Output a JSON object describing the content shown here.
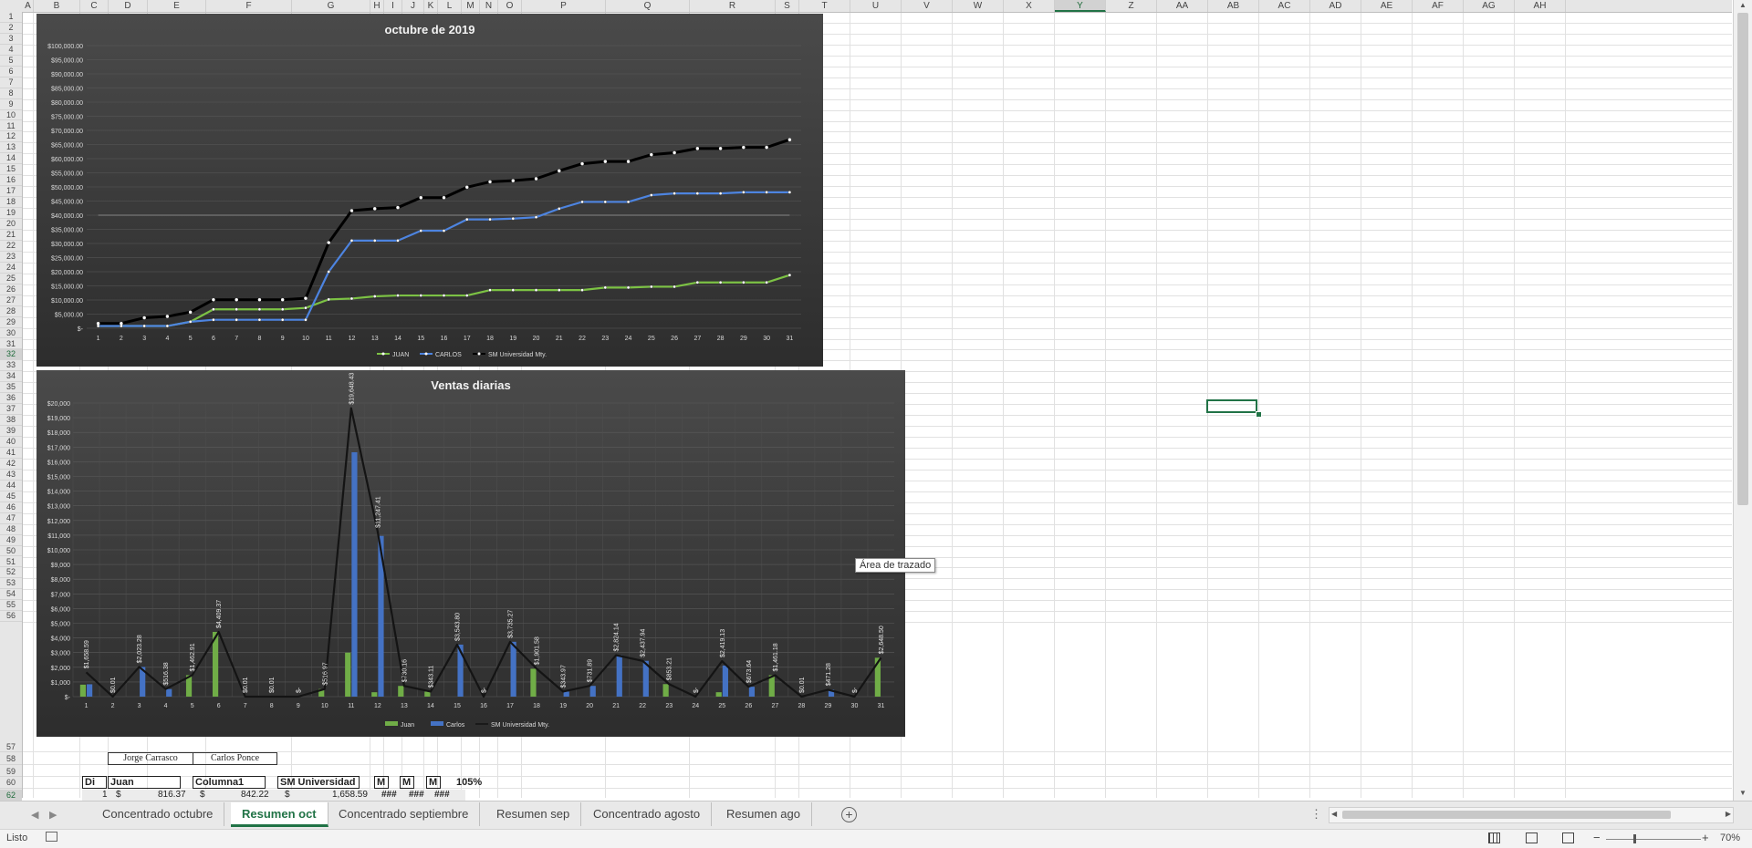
{
  "columns": [
    "A",
    "B",
    "C",
    "D",
    "E",
    "F",
    "G",
    "H",
    "I",
    "J",
    "K",
    "L",
    "M",
    "N",
    "O",
    "P",
    "Q",
    "R",
    "S",
    "T",
    "U",
    "V",
    "W",
    "X",
    "Y",
    "Z",
    "AA",
    "AB",
    "AC",
    "AD",
    "AE",
    "AF",
    "AG",
    "AH"
  ],
  "selected_column": "Y",
  "rows_top": [
    "1",
    "2",
    "3",
    "4",
    "5",
    "6",
    "7",
    "8",
    "9",
    "10",
    "11",
    "12",
    "13",
    "14",
    "15",
    "16",
    "17",
    "18",
    "19",
    "20",
    "21",
    "22",
    "23",
    "24",
    "25",
    "26",
    "27",
    "28",
    "29",
    "30",
    "31",
    "32",
    "33",
    "34",
    "35",
    "36",
    "37",
    "38",
    "39",
    "40",
    "41",
    "42",
    "43",
    "44",
    "45",
    "46",
    "47",
    "48",
    "49",
    "50",
    "51",
    "52",
    "53",
    "54",
    "55",
    "56"
  ],
  "rows_bottom": [
    "57",
    "58",
    "59",
    "60",
    "62"
  ],
  "selected_row": "32",
  "chart1": {
    "title": "octubre de 2019",
    "y_ticks": [
      "$100,000.00",
      "$95,000.00",
      "$90,000.00",
      "$85,000.00",
      "$80,000.00",
      "$75,000.00",
      "$70,000.00",
      "$65,000.00",
      "$60,000.00",
      "$55,000.00",
      "$50,000.00",
      "$45,000.00",
      "$40,000.00",
      "$35,000.00",
      "$30,000.00",
      "$25,000.00",
      "$20,000.00",
      "$15,000.00",
      "$10,000.00",
      "$5,000.00",
      "$-"
    ],
    "legend": [
      "JUAN",
      "CARLOS",
      "SM Universidad  Mty."
    ]
  },
  "chart2": {
    "title": "Ventas diarias",
    "y_ticks": [
      "$20,000",
      "$19,000",
      "$18,000",
      "$17,000",
      "$16,000",
      "$15,000",
      "$14,000",
      "$13,000",
      "$12,000",
      "$11,000",
      "$10,000",
      "$9,000",
      "$8,000",
      "$7,000",
      "$6,000",
      "$5,000",
      "$4,000",
      "$3,000",
      "$2,000",
      "$1,000",
      "$-"
    ],
    "data_labels": [
      "$1,658.59",
      "$0.01",
      "$2,023.28",
      "$516.38",
      "$1,462.91",
      "$4,409.37",
      "$0.01",
      "$0.01",
      "$-",
      "$516.97",
      "$19,648.43",
      "$11,247.41",
      "$730.16",
      "$343.11",
      "$3,543.80",
      "$-",
      "$3,735.27",
      "$1,901.58",
      "$343.97",
      "$731.89",
      "$2,824.14",
      "$2,437.94",
      "$853.21",
      "$-",
      "$2,419.13",
      "$673.64",
      "$1,461.18",
      "$0.01",
      "$471.28",
      "$-",
      "$2,648.50"
    ],
    "legend": [
      "Juan",
      "Carlos",
      "SM Universidad  Mty."
    ]
  },
  "chart_data": [
    {
      "type": "line",
      "title": "octubre de 2019",
      "x": [
        1,
        2,
        3,
        4,
        5,
        6,
        7,
        8,
        9,
        10,
        11,
        12,
        13,
        14,
        15,
        16,
        17,
        18,
        19,
        20,
        21,
        22,
        23,
        24,
        25,
        26,
        27,
        28,
        29,
        30,
        31
      ],
      "ylim": [
        0,
        100000
      ],
      "reference_line": 40000,
      "series": [
        {
          "name": "JUAN",
          "color": "#7cc244",
          "values": [
            800,
            800,
            800,
            800,
            2300,
            6700,
            6700,
            6700,
            6700,
            7200,
            10200,
            10500,
            11300,
            11600,
            11600,
            11600,
            11600,
            13500,
            13500,
            13500,
            13500,
            13500,
            14400,
            14400,
            14700,
            14700,
            16200,
            16200,
            16200,
            16200,
            18800
          ]
        },
        {
          "name": "CARLOS",
          "color": "#4d84e0",
          "values": [
            800,
            800,
            800,
            800,
            2300,
            3000,
            3000,
            3000,
            3000,
            3000,
            20000,
            31000,
            31000,
            31000,
            34500,
            34500,
            38500,
            38500,
            38800,
            39300,
            42300,
            44700,
            44700,
            44700,
            47100,
            47700,
            47700,
            47700,
            48100,
            48100,
            48100
          ]
        },
        {
          "name": "SM Universidad  Mty.",
          "color": "#000000",
          "values": [
            1700,
            1700,
            3700,
            4200,
            5700,
            10100,
            10100,
            10100,
            10100,
            10600,
            30300,
            41600,
            42300,
            42700,
            46200,
            46200,
            49900,
            51800,
            52200,
            52900,
            55700,
            58200,
            59000,
            59000,
            61400,
            62100,
            63600,
            63600,
            64000,
            64000,
            66700
          ]
        }
      ]
    },
    {
      "type": "bar",
      "title": "Ventas diarias",
      "categories": [
        "1",
        "2",
        "3",
        "4",
        "5",
        "6",
        "7",
        "8",
        "9",
        "10",
        "11",
        "12",
        "13",
        "14",
        "15",
        "16",
        "17",
        "18",
        "19",
        "20",
        "21",
        "22",
        "23",
        "24",
        "25",
        "26",
        "27",
        "28",
        "29",
        "30",
        "31"
      ],
      "ylim": [
        0,
        20000
      ],
      "series": [
        {
          "name": "Juan",
          "type": "bar",
          "color": "#70ad47",
          "values": [
            816.37,
            0.01,
            0,
            0,
            1462.91,
            4409.37,
            0.01,
            0.01,
            0,
            516.97,
            3000,
            300,
            730.16,
            343.11,
            0,
            0,
            0,
            1901.58,
            0,
            0,
            0,
            0,
            853.21,
            0,
            300,
            0,
            1461.18,
            0.01,
            0,
            0,
            2648.5
          ]
        },
        {
          "name": "Carlos",
          "type": "bar",
          "color": "#4472c4",
          "values": [
            842.22,
            0,
            2023.28,
            516.38,
            0,
            0,
            0,
            0,
            0,
            0,
            16648.43,
            10947.41,
            0,
            0,
            3543.8,
            0,
            3735.27,
            0,
            343.97,
            731.89,
            2824.14,
            2437.94,
            0,
            0,
            2119.13,
            673.64,
            0,
            0,
            471.28,
            0,
            0
          ]
        },
        {
          "name": "SM Universidad  Mty.",
          "type": "line",
          "color": "#1a1a1a",
          "values": [
            1658.59,
            0.01,
            2023.28,
            516.38,
            1462.91,
            4409.37,
            0.01,
            0.01,
            0,
            516.97,
            19648.43,
            11247.41,
            730.16,
            343.11,
            3543.8,
            0,
            3735.27,
            1901.58,
            343.97,
            731.89,
            2824.14,
            2437.94,
            853.21,
            0,
            2419.13,
            673.64,
            1461.18,
            0.01,
            471.28,
            0,
            2648.5
          ]
        }
      ]
    }
  ],
  "tooltip": "Área de trazado",
  "table": {
    "names": [
      "Jorge Carrasco",
      "Carlos Ponce"
    ],
    "headers": [
      "Di",
      "Juan",
      "Columna1",
      "SM Universidad",
      "M",
      "M",
      "M",
      "105%"
    ],
    "row": {
      "day": "1",
      "cur1": "$",
      "v1": "816.37",
      "cur2": "$",
      "v2": "842.22",
      "cur3": "$",
      "v3": "1,658.59",
      "h1": "###",
      "h2": "###",
      "h3": "###"
    }
  },
  "sheets": [
    "Concentrado octubre",
    "Resumen oct",
    "Concentrado septiembre",
    "Resumen sep",
    "Concentrado agosto",
    "Resumen ago"
  ],
  "active_sheet": "Resumen oct",
  "status": {
    "ready": "Listo",
    "zoom": "70%",
    "zoom_minus": "−",
    "zoom_plus": "+"
  }
}
